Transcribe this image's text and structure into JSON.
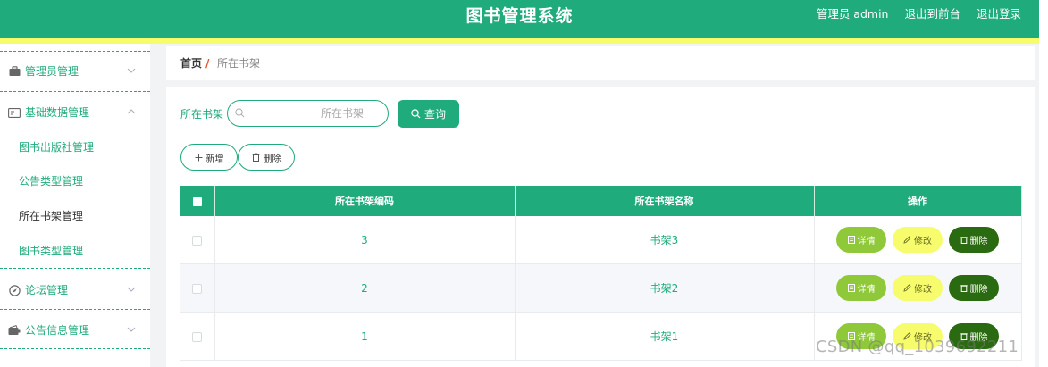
{
  "header": {
    "title": "图书管理系统",
    "user": "管理员 admin",
    "to_front": "退出到前台",
    "logout": "退出登录"
  },
  "sidebar": {
    "menus": [
      {
        "label": "管理员管理",
        "icon": "briefcase-icon",
        "expanded": false
      },
      {
        "label": "基础数据管理",
        "icon": "id-card-icon",
        "expanded": true,
        "children": [
          "图书出版社管理",
          "公告类型管理",
          "所在书架管理",
          "图书类型管理"
        ],
        "active_child": "所在书架管理"
      },
      {
        "label": "论坛管理",
        "icon": "compass-icon",
        "expanded": false
      },
      {
        "label": "公告信息管理",
        "icon": "wallet-icon",
        "expanded": false
      }
    ]
  },
  "breadcrumb": {
    "home": "首页",
    "separator": "/",
    "current": "所在书架"
  },
  "search": {
    "label": "所在书架",
    "placeholder": "所在书架",
    "value": "",
    "button": "查询"
  },
  "toolbar": {
    "add": "新增",
    "delete": "删除"
  },
  "table": {
    "columns": [
      "所在书架编码",
      "所在书架名称",
      "操作"
    ],
    "rows": [
      {
        "code": "3",
        "name": "书架3"
      },
      {
        "code": "2",
        "name": "书架2"
      },
      {
        "code": "1",
        "name": "书架1"
      }
    ],
    "actions": {
      "detail": "详情",
      "edit": "修改",
      "delete": "删除"
    }
  },
  "watermark": "CSDN @qq_1039692211",
  "colors": {
    "primary": "#1fab7b",
    "accent_yellow": "#f6fc6c",
    "detail": "#8fc93a",
    "delete": "#2a6a10"
  }
}
